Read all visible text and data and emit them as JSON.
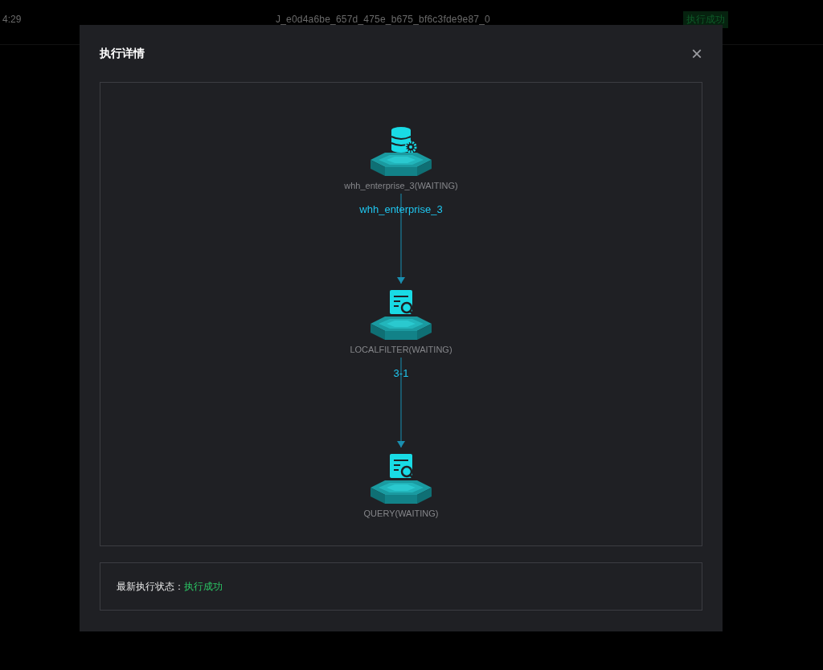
{
  "background_row": {
    "time": "4:29",
    "job_id": "J_e0d4a6be_657d_475e_b675_bf6c3fde9e87_0",
    "status_badge": "执行成功"
  },
  "dialog": {
    "title": "执行详情",
    "close": "×",
    "graph": {
      "nodes": [
        {
          "label": "whh_enterprise_3(WAITING)",
          "kind": "database"
        },
        {
          "label": "LOCALFILTER(WAITING)",
          "kind": "filter"
        },
        {
          "label": "QUERY(WAITING)",
          "kind": "query"
        }
      ],
      "edges": [
        {
          "label": "whh_enterprise_3"
        },
        {
          "label": "3-1"
        }
      ]
    },
    "status": {
      "label": "最新执行状态：",
      "value": "执行成功"
    }
  }
}
